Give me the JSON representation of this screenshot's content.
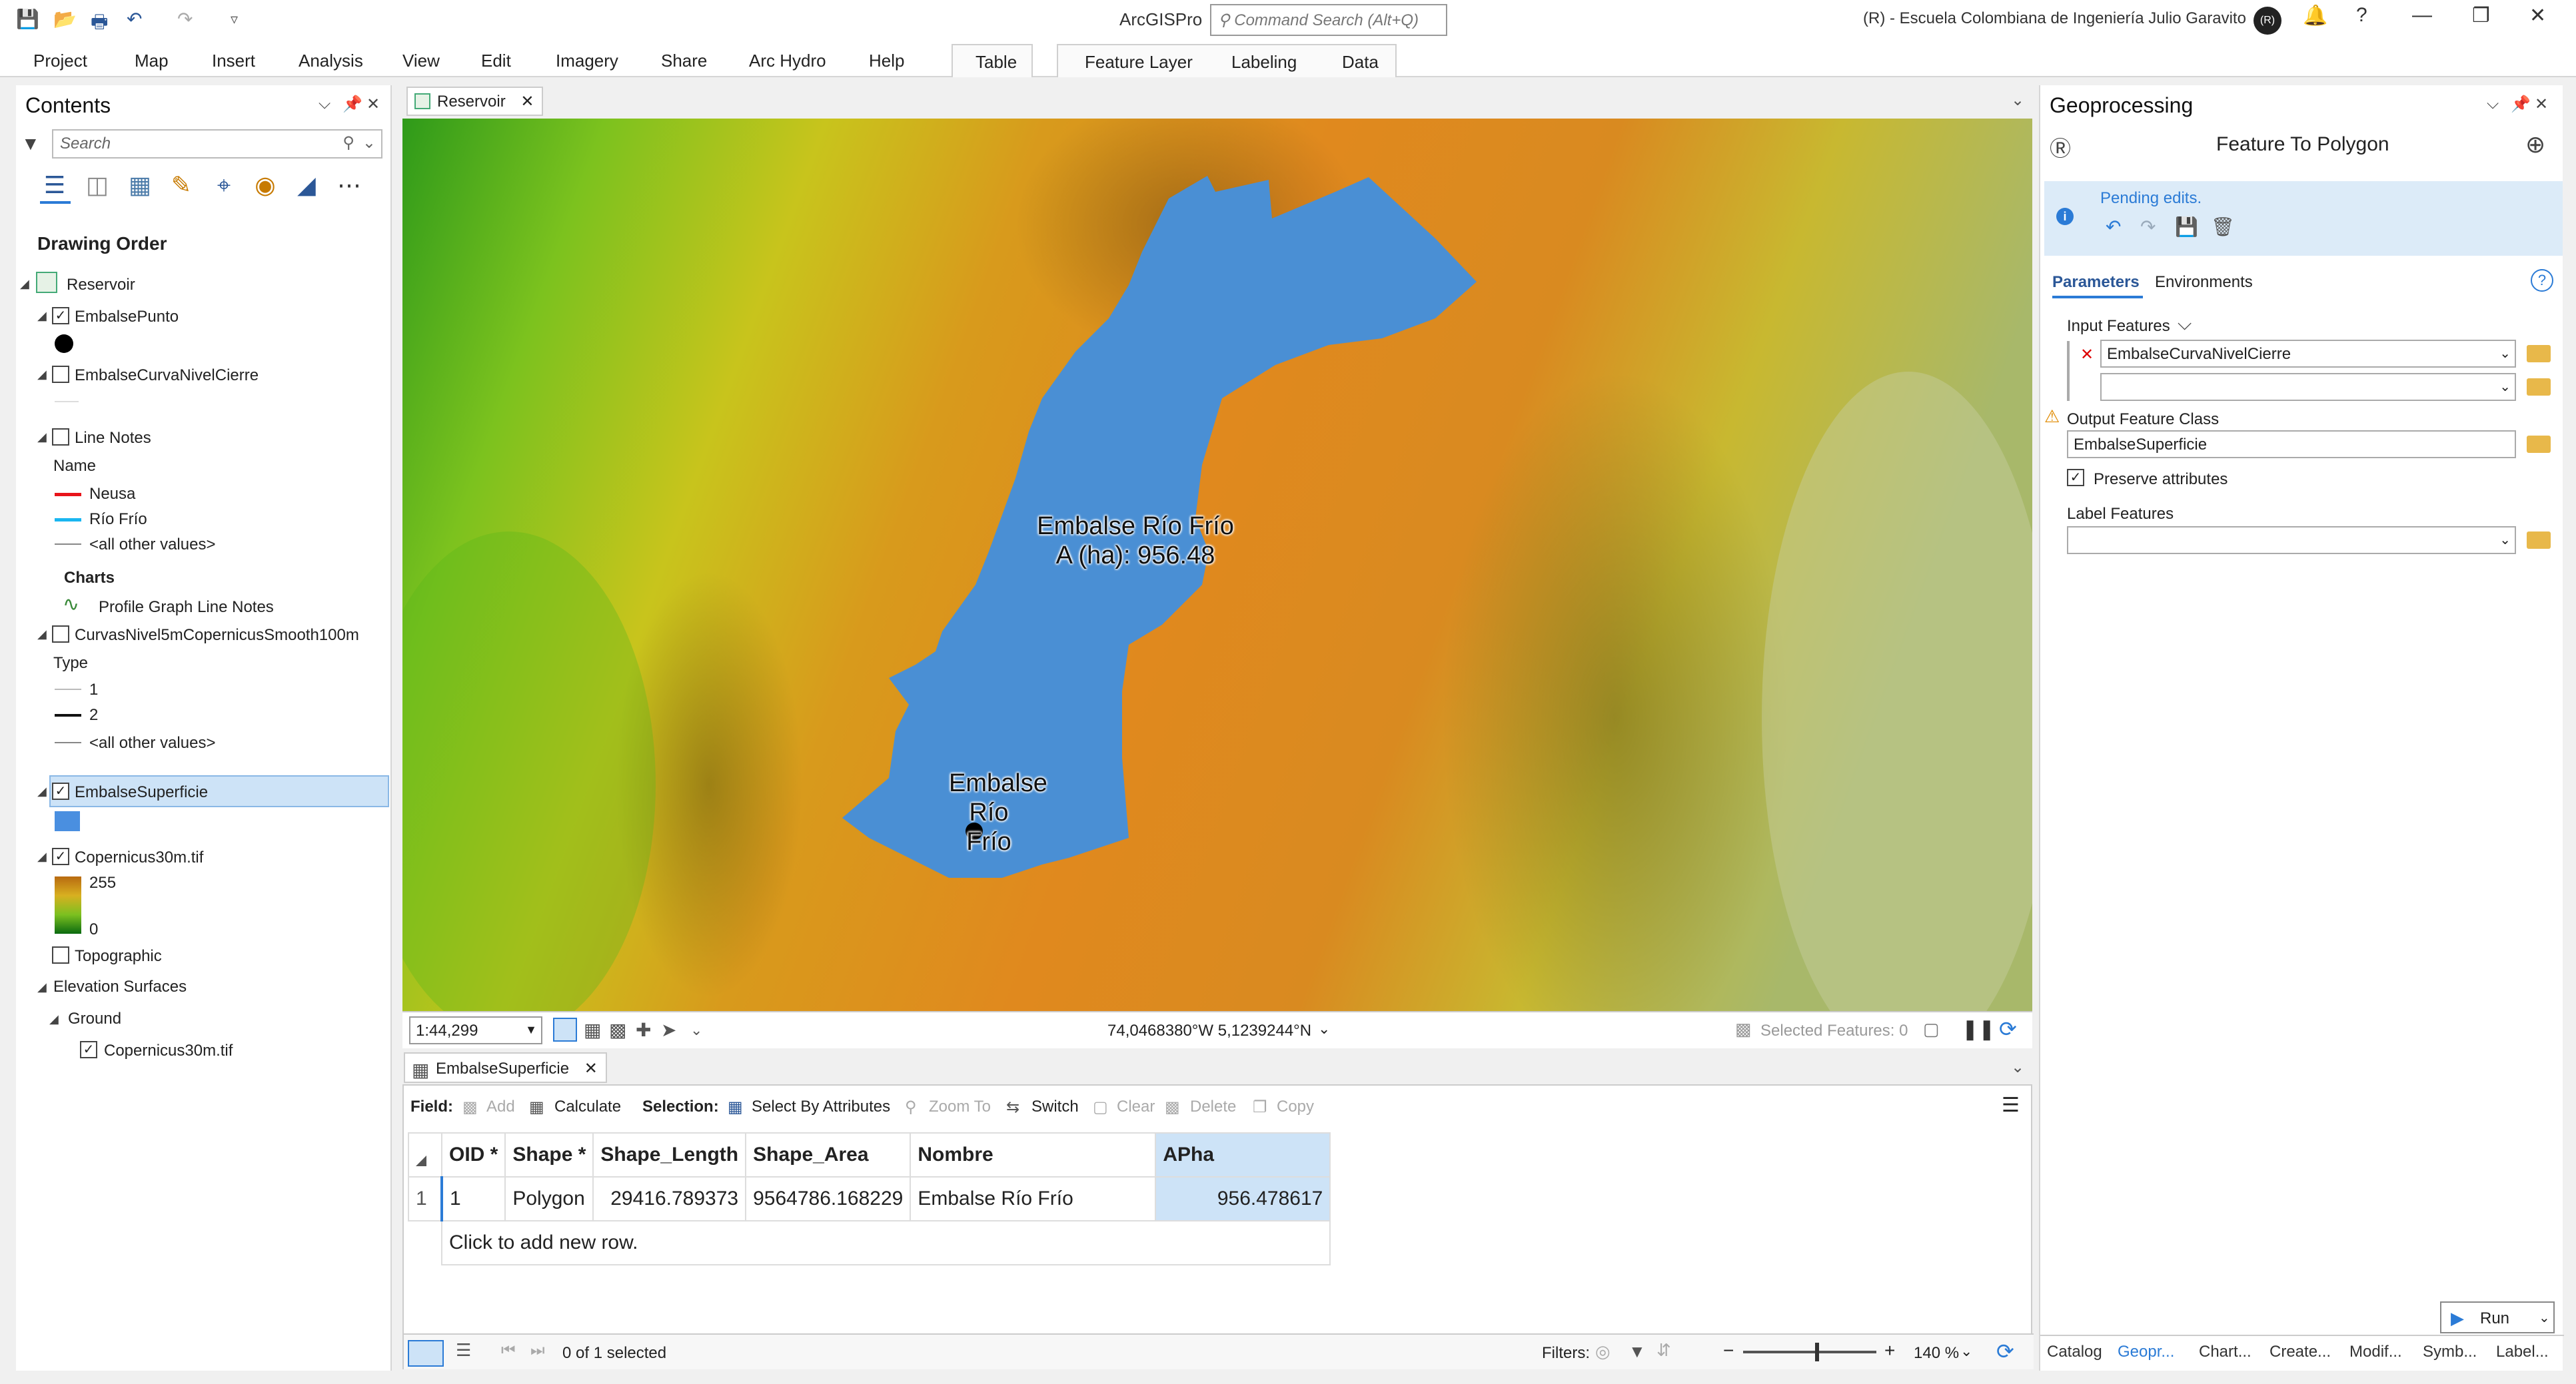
{
  "titlebar": {
    "app_name": "ArcGISPro",
    "command_search_placeholder": "Command Search (Alt+Q)",
    "org": "(R) - Escuela Colombiana de Ingeniería Julio Garavito",
    "avatar": "(R)"
  },
  "ribbon": {
    "tabs": [
      "Project",
      "Map",
      "Insert",
      "Analysis",
      "View",
      "Edit",
      "Imagery",
      "Share",
      "Arc Hydro",
      "Help"
    ],
    "table_tab": "Table",
    "feature_layer_tabs": [
      "Feature Layer",
      "Labeling",
      "Data"
    ]
  },
  "contents": {
    "title": "Contents",
    "search_placeholder": "Search",
    "drawing_order": "Drawing Order",
    "map_name": "Reservoir",
    "layers": {
      "embalse_punto": "EmbalsePunto",
      "curva_cierre": "EmbalseCurvaNivelCierre",
      "line_notes": "Line Notes",
      "line_notes_field": "Name",
      "neusa": "Neusa",
      "rio_frio": "Río Frío",
      "all_other_1": "<all other values>",
      "charts": "Charts",
      "profile_graph": "Profile Graph Line Notes",
      "curvas": "CurvasNivel5mCopernicusSmooth100m",
      "type_field": "Type",
      "type1": "1",
      "type2": "2",
      "all_other_2": "<all other values>",
      "superficie": "EmbalseSuperficie",
      "copernicus": "Copernicus30m.tif",
      "high": "255",
      "low": "0",
      "topographic": "Topographic",
      "elevation_surfaces": "Elevation Surfaces",
      "ground": "Ground",
      "ground_layer": "Copernicus30m.tif"
    },
    "colors": {
      "neusa": "#e8141a",
      "rio_frio": "#1ab6f0",
      "superficie": "#4a8fe0"
    }
  },
  "map": {
    "tab": "Reservoir",
    "label_polygon": [
      "Embalse Río Frío",
      "A (ha): 956.48"
    ],
    "label_point": [
      "Embalse",
      "Río Frío"
    ],
    "scale": "1:44,299",
    "coordinates": "74,0468380°W 5,1239244°N",
    "selected_features": "Selected Features: 0"
  },
  "table": {
    "tab": "EmbalseSuperficie",
    "toolbar": {
      "field": "Field:",
      "add": "Add",
      "calculate": "Calculate",
      "selection": "Selection:",
      "select_by_attr": "Select By Attributes",
      "zoom_to": "Zoom To",
      "switch": "Switch",
      "clear": "Clear",
      "delete": "Delete",
      "copy": "Copy"
    },
    "columns": [
      "OID *",
      "Shape *",
      "Shape_Length",
      "Shape_Area",
      "Nombre",
      "APha"
    ],
    "row": {
      "num": "1",
      "oid": "1",
      "shape": "Polygon",
      "length": "29416.789373",
      "area": "9564786.168229",
      "nombre": "Embalse Río Frío",
      "apha": "956.478617"
    },
    "add_row": "Click to add new row.",
    "selected": "0 of 1 selected",
    "filters": "Filters:",
    "zoom": "140 %"
  },
  "geoprocessing": {
    "title": "Geoprocessing",
    "tool": "Feature To Polygon",
    "pending": "Pending edits.",
    "tabs": [
      "Parameters",
      "Environments"
    ],
    "input_label": "Input Features",
    "input_value": "EmbalseCurvaNivelCierre",
    "output_label": "Output Feature Class",
    "output_value": "EmbalseSuperficie",
    "preserve": "Preserve attributes",
    "label_features": "Label Features",
    "run": "Run",
    "bottom_tabs": [
      "Catalog",
      "Geopr...",
      "Chart...",
      "Create...",
      "Modif...",
      "Symb...",
      "Label..."
    ]
  }
}
